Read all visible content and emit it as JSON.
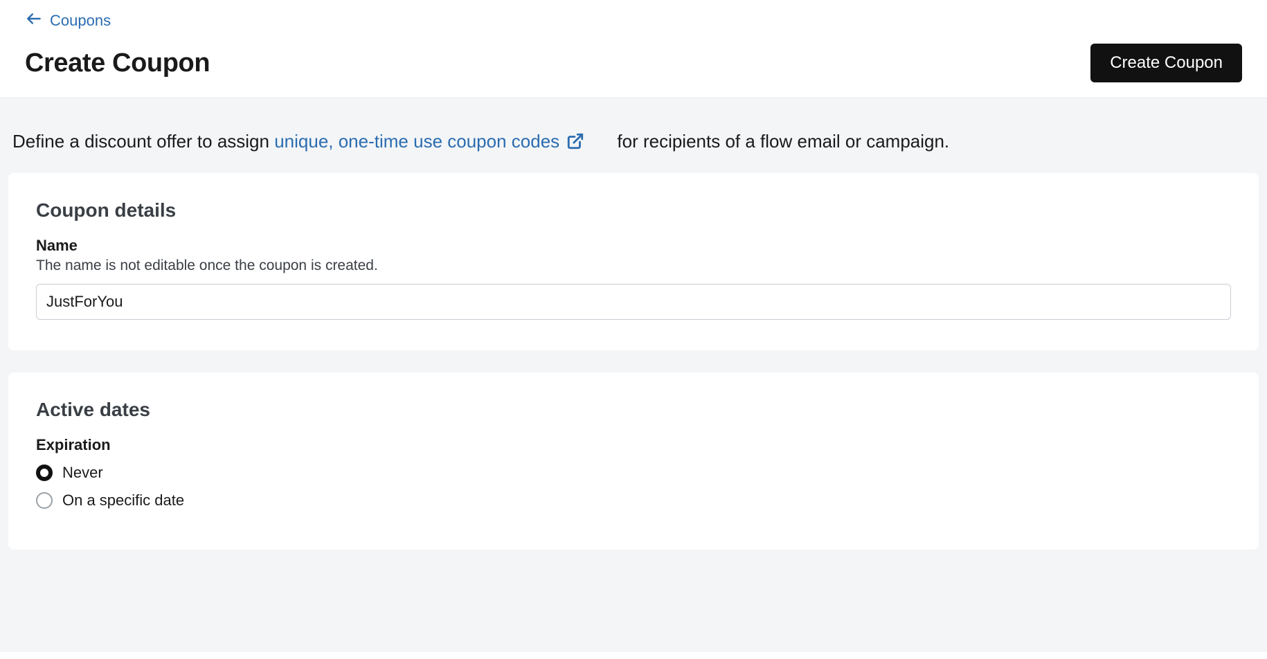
{
  "breadcrumb": {
    "link_text": "Coupons"
  },
  "header": {
    "title": "Create Coupon",
    "primary_button": "Create Coupon"
  },
  "intro": {
    "prefix": "Define a discount offer to assign ",
    "link": "unique, one-time use coupon codes",
    "suffix": " for recipients of a flow email or campaign."
  },
  "coupon_details": {
    "section_title": "Coupon details",
    "name_label": "Name",
    "name_help": "The name is not editable once the coupon is created.",
    "name_value": "JustForYou"
  },
  "active_dates": {
    "section_title": "Active dates",
    "expiration_label": "Expiration",
    "options": {
      "never": "Never",
      "specific": "On a specific date"
    },
    "selected": "never"
  }
}
